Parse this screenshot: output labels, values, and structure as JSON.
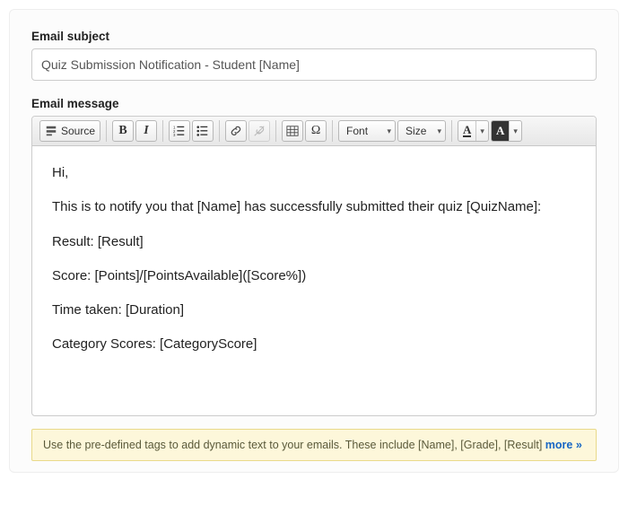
{
  "subject": {
    "label": "Email subject",
    "value": "Quiz Submission Notification - Student [Name]"
  },
  "message": {
    "label": "Email message",
    "body_paragraphs": [
      "Hi,",
      "This is to notify you that [Name] has successfully submitted their quiz [QuizName]:",
      "Result: [Result]",
      "Score: [Points]/[PointsAvailable]([Score%])",
      "Time taken: [Duration]",
      "Category Scores: [CategoryScore]"
    ]
  },
  "toolbar": {
    "source_label": "Source",
    "font_label": "Font",
    "size_label": "Size"
  },
  "hint": {
    "text": "Use the pre-defined tags to add dynamic text to your emails. These include [Name], [Grade], [Result] ",
    "more": "more »"
  }
}
